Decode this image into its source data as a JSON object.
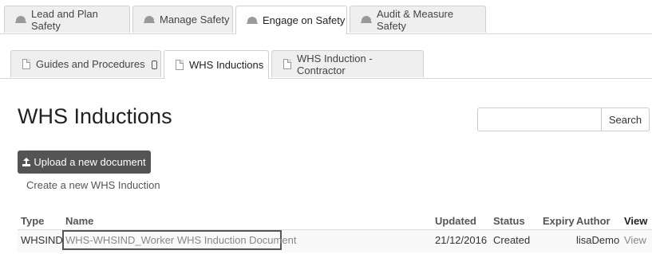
{
  "top_tabs": [
    {
      "label": "Lead and Plan Safety",
      "icon": "dome-icon",
      "active": false
    },
    {
      "label": "Manage Safety",
      "icon": "dome-icon",
      "active": false
    },
    {
      "label": "Engage on Safety",
      "icon": "dome-icon",
      "active": true
    },
    {
      "label": "Audit & Measure Safety",
      "icon": "dome-icon",
      "active": false
    }
  ],
  "sub_tabs": [
    {
      "label": "Guides and Procedures",
      "icon": "document-icon",
      "extra_icon": "mobile-icon",
      "active": false
    },
    {
      "label": "WHS Inductions",
      "icon": "document-icon",
      "active": true
    },
    {
      "label": "WHS Induction - Contractor",
      "icon": "document-icon",
      "active": false
    }
  ],
  "page": {
    "title": "WHS Inductions",
    "upload_label": "Upload a new document",
    "hint": "Create a new WHS Induction"
  },
  "search": {
    "placeholder": "",
    "button_label": "Search"
  },
  "table": {
    "headers": [
      "Type",
      "Name",
      "Updated",
      "Status",
      "Expiry",
      "Author",
      "View"
    ],
    "rows": [
      {
        "type": "WHSIND",
        "name": "WHS-WHSIND_Worker WHS Induction Document",
        "updated": "21/12/2016",
        "status": "Created",
        "expiry": "",
        "author": "lisaDemo",
        "view": "View"
      }
    ]
  },
  "colors": {
    "tab_inactive_bg": "#efefef",
    "upload_button_bg": "#545454",
    "link_text": "#888888"
  }
}
